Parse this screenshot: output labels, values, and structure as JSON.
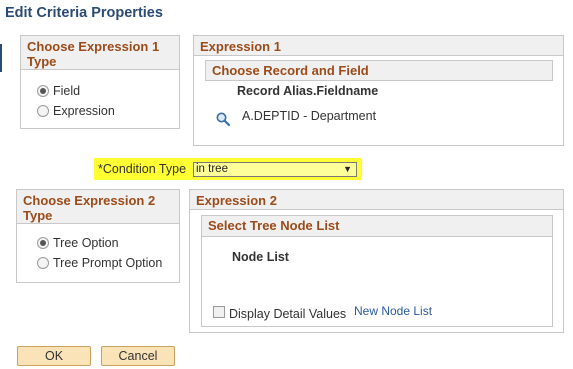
{
  "page": {
    "title": "Edit Criteria Properties"
  },
  "expr1_type": {
    "header": "Choose Expression 1 Type",
    "options": [
      {
        "label": "Field",
        "checked": true
      },
      {
        "label": "Expression",
        "checked": false
      }
    ]
  },
  "expr1": {
    "header": "Expression 1",
    "sub_header": "Choose Record and Field",
    "column_label": "Record Alias.Fieldname",
    "value": "A.DEPTID - Department",
    "lookup_icon": "magnifier-icon"
  },
  "condition": {
    "label": "*Condition Type",
    "selected": "in tree",
    "highlight_color": "#ffff33"
  },
  "expr2_type": {
    "header": "Choose Expression 2 Type",
    "options": [
      {
        "label": "Tree Option",
        "checked": true
      },
      {
        "label": "Tree Prompt Option",
        "checked": false
      }
    ]
  },
  "expr2": {
    "header": "Expression 2",
    "sub_header": "Select Tree Node List",
    "node_list_label": "Node List",
    "checkbox_label": "Display Detail Values",
    "link": "New Node List"
  },
  "buttons": {
    "ok": "OK",
    "cancel": "Cancel"
  },
  "colors": {
    "header_text": "#9c4b1a",
    "title": "#2c4b73",
    "button_bg": "#fbe3b8",
    "link": "#2c5aa0"
  }
}
